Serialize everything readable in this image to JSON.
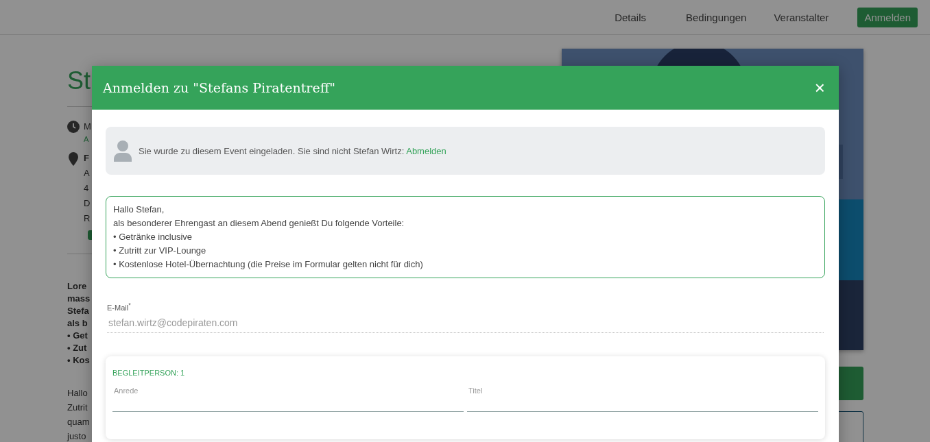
{
  "nav": {
    "items": [
      {
        "label": "Details"
      },
      {
        "label": "Bedingungen"
      },
      {
        "label": "Veranstalter"
      }
    ],
    "register_button": "Anmelden"
  },
  "page": {
    "title": "St",
    "date_line": "M",
    "date_sub": "A",
    "location_name": "F",
    "address_lines": [
      "A",
      "4",
      "D"
    ],
    "address_note": "R",
    "description_bold": [
      "Lore",
      "mass",
      "Stefa",
      "als b",
      "• Get",
      "• Zut",
      "• Kos"
    ],
    "description": [
      "Hallo",
      "Zutrit",
      "quam",
      "justo"
    ]
  },
  "modal": {
    "title": "Anmelden zu \"Stefans Piratentreff\"",
    "close": "×",
    "invitation": {
      "text": "Sie wurde zu diesem Event eingeladen. Sie sind nicht Stefan Wirtz: ",
      "link": "Abmelden"
    },
    "message_lines": [
      "Hallo Stefan,",
      "als besonderer Ehrengast an diesem Abend genießt Du folgende Vorteile:",
      "• Getränke inclusive",
      "• Zutritt zur VIP-Lounge",
      "• Kostenlose Hotel-Übernachtung (die Preise im Formular gelten nicht für dich)"
    ],
    "email": {
      "label": "E-Mail",
      "required_mark": "*",
      "value": "stefan.wirtz@codepiraten.com"
    },
    "companion": {
      "heading": "BEGLEITPERSON: 1",
      "fields": [
        {
          "label": "Anrede"
        },
        {
          "label": "Titel"
        }
      ]
    }
  }
}
